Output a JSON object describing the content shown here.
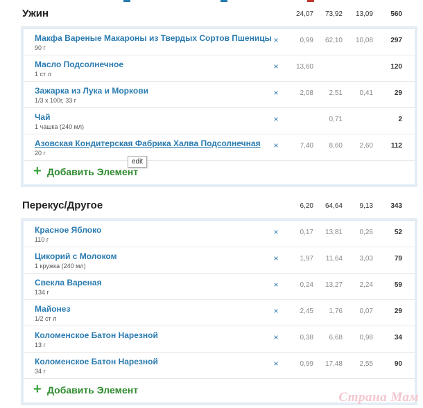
{
  "colors": {
    "link": "#2a7bb0",
    "add": "#3aa53a",
    "panel_border": "#e4edf5"
  },
  "sections": [
    {
      "title": "Ужин",
      "totals": [
        "24,07",
        "73,92",
        "13,09",
        "560"
      ],
      "items": [
        {
          "name": "Макфа Вареные Макароны из Твердых Сортов Пшеницы",
          "portion": "90 г",
          "values": [
            "0,99",
            "62,10",
            "10,08",
            "297"
          ]
        },
        {
          "name": "Масло Подсолнечное",
          "portion": "1 ст л",
          "values": [
            "13,60",
            "",
            "",
            "120"
          ]
        },
        {
          "name": "Зажарка из Лука и Моркови",
          "portion": "1/3 x 100г, 33 г",
          "values": [
            "2,08",
            "2,51",
            "0,41",
            "29"
          ]
        },
        {
          "name": "Чай",
          "portion": "1 чашка (240 мл)",
          "values": [
            "",
            "0,71",
            "",
            "2"
          ]
        },
        {
          "name": "Азовская Кондитерская Фабрика Халва Подсолнечная",
          "portion": "20 г",
          "values": [
            "7,40",
            "8,60",
            "2,60",
            "112"
          ]
        }
      ],
      "add_label": "Добавить Элемент",
      "add_icon": "plus-icon"
    },
    {
      "title": "Перекус/Другое",
      "totals": [
        "6,20",
        "64,64",
        "9,13",
        "343"
      ],
      "items": [
        {
          "name": "Красное Яблоко",
          "portion": "110 г",
          "values": [
            "0,17",
            "13,81",
            "0,26",
            "52"
          ]
        },
        {
          "name": "Цикорий с Молоком",
          "portion": "1 кружка (240 мл)",
          "values": [
            "1,97",
            "11,64",
            "3,03",
            "79"
          ]
        },
        {
          "name": "Свекла Вареная",
          "portion": "134 г",
          "values": [
            "0,24",
            "13,27",
            "2,24",
            "59"
          ]
        },
        {
          "name": "Майонез",
          "portion": "1/2 ст л",
          "values": [
            "2,45",
            "1,76",
            "0,07",
            "29"
          ]
        },
        {
          "name": "Коломенское Батон Нарезной",
          "portion": "13 г",
          "values": [
            "0,38",
            "6,68",
            "0,98",
            "34"
          ]
        },
        {
          "name": "Коломенское Батон Нарезной",
          "portion": "34 г",
          "values": [
            "0,99",
            "17,48",
            "2,55",
            "90"
          ]
        }
      ],
      "add_label": "Добавить Элемент",
      "add_icon": "plus-icon"
    }
  ],
  "delete_glyph": "×",
  "tooltip": "edit",
  "watermark": "Страна Мам"
}
